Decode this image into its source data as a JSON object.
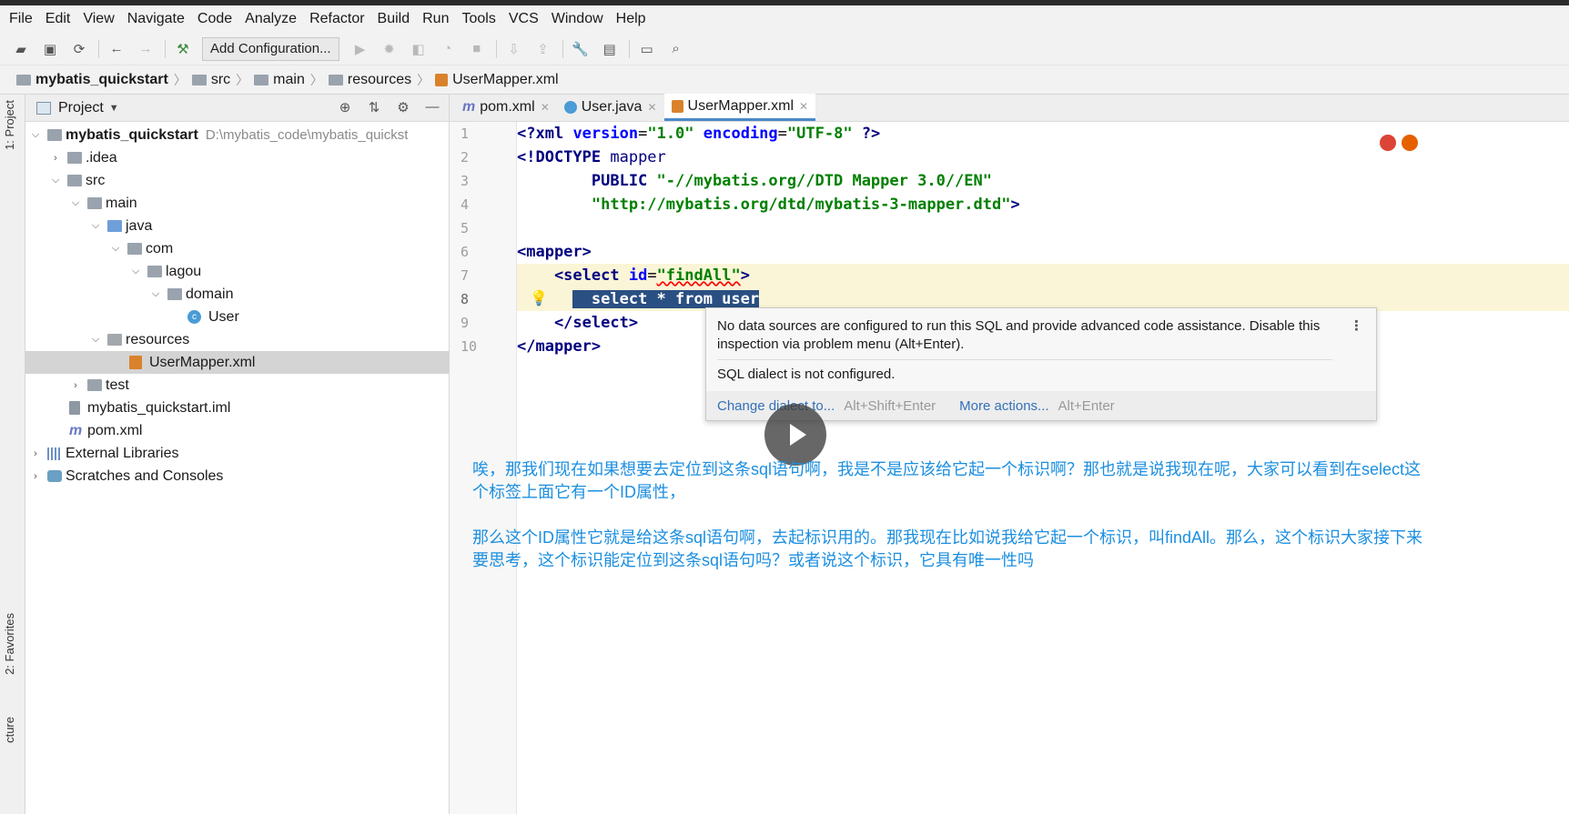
{
  "menu": [
    "File",
    "Edit",
    "View",
    "Navigate",
    "Code",
    "Analyze",
    "Refactor",
    "Build",
    "Run",
    "Tools",
    "VCS",
    "Window",
    "Help"
  ],
  "toolbar": {
    "run_config": "Add Configuration..."
  },
  "breadcrumbs": [
    "mybatis_quickstart",
    "src",
    "main",
    "resources",
    "UserMapper.xml"
  ],
  "left_stripe": {
    "project": "1: Project",
    "favorites": "2: Favorites",
    "structure": "cture"
  },
  "project_panel": {
    "title": "Project",
    "root_path": "D:\\mybatis_code\\mybatis_quickst",
    "items": [
      {
        "label": "mybatis_quickstart"
      },
      {
        "label": ".idea"
      },
      {
        "label": "src"
      },
      {
        "label": "main"
      },
      {
        "label": "java"
      },
      {
        "label": "com"
      },
      {
        "label": "lagou"
      },
      {
        "label": "domain"
      },
      {
        "label": "User"
      },
      {
        "label": "resources"
      },
      {
        "label": "UserMapper.xml"
      },
      {
        "label": "test"
      },
      {
        "label": "mybatis_quickstart.iml"
      },
      {
        "label": "pom.xml"
      },
      {
        "label": "External Libraries"
      },
      {
        "label": "Scratches and Consoles"
      }
    ]
  },
  "tabs": [
    {
      "label": "pom.xml",
      "icon": "m"
    },
    {
      "label": "User.java",
      "icon": "c"
    },
    {
      "label": "UserMapper.xml",
      "icon": "x"
    }
  ],
  "editor": {
    "line_numbers": [
      "1",
      "2",
      "3",
      "4",
      "5",
      "6",
      "7",
      "8",
      "9",
      "10"
    ],
    "code": {
      "l1_a": "<?",
      "l1_b": "xml ",
      "l1_c": "version",
      "l1_d": "=",
      "l1_e": "\"1.0\"",
      "l1_f": " encoding",
      "l1_g": "=",
      "l1_h": "\"UTF-8\"",
      "l1_i": " ?>",
      "l2_a": "<!DOCTYPE ",
      "l2_b": "mapper",
      "l3_a": "        PUBLIC ",
      "l3_b": "\"-//mybatis.org//DTD Mapper 3.0//EN\"",
      "l4_a": "        ",
      "l4_b": "\"http://mybatis.org/dtd/mybatis-3-mapper.dtd\"",
      "l4_c": ">",
      "l6": "<mapper>",
      "l7_a": "    <select ",
      "l7_b": "id",
      "l7_c": "=",
      "l7_d": "\"findAll\"",
      "l7_e": ">",
      "l8_a": "      ",
      "l8_b": "  select * from user",
      "l9": "    </select>",
      "l10": "</mapper>"
    }
  },
  "popup": {
    "message": "No data sources are configured to run this SQL and provide advanced code assistance. Disable this inspection via problem menu (Alt+Enter).",
    "message2": "SQL dialect is not configured.",
    "action1": "Change dialect to...",
    "action1_shortcut": "Alt+Shift+Enter",
    "action2": "More actions...",
    "action2_shortcut": "Alt+Enter"
  },
  "subtitles": {
    "p1": "唉，那我们现在如果想要去定位到这条sql语句啊，我是不是应该给它起一个标识啊？那也就是说我现在呢，大家可以看到在select这个标签上面它有一个ID属性，",
    "p2": "那么这个ID属性它就是给这条sql语句啊，去起标识用的。那我现在比如说我给它起一个标识，叫findAll。那么，这个标识大家接下来要思考，这个标识能定位到这条sql语句吗？或者说这个标识，它具有唯一性吗"
  },
  "colors": {
    "accent": "#4a88c7",
    "subtitle": "#1c8fe0",
    "selection": "#2a4f82",
    "line_highlight": "#fbf5d7"
  }
}
